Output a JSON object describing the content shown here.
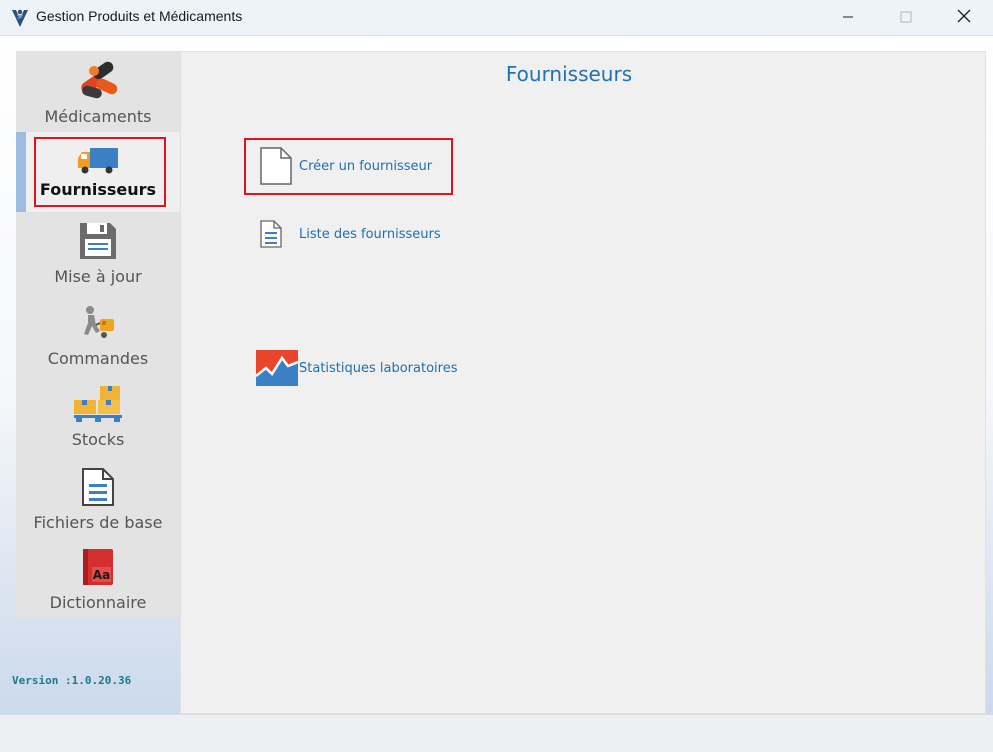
{
  "window": {
    "title": "Gestion Produits et Médicaments",
    "icon": "caduceus-icon"
  },
  "sidebar": {
    "items": [
      {
        "label": "Médicaments",
        "icon": "pills-icon",
        "active": false
      },
      {
        "label": "Fournisseurs",
        "icon": "truck-icon",
        "active": true
      },
      {
        "label": "Mise à jour",
        "icon": "floppy-disk-icon",
        "active": false
      },
      {
        "label": "Commandes",
        "icon": "delivery-man-icon",
        "active": false
      },
      {
        "label": "Stocks",
        "icon": "boxes-pallet-icon",
        "active": false
      },
      {
        "label": "Fichiers de base",
        "icon": "document-icon",
        "active": false
      },
      {
        "label": "Dictionnaire",
        "icon": "dictionary-icon",
        "active": false
      }
    ],
    "version": "Version :1.0.20.36"
  },
  "main": {
    "title": "Fournisseurs",
    "actions": [
      {
        "label": "Créer un fournisseur",
        "icon": "new-document-icon",
        "highlighted": true
      },
      {
        "label": "Liste des fournisseurs",
        "icon": "list-document-icon",
        "highlighted": false
      },
      {
        "label": "Statistiques laboratoires",
        "icon": "statistics-chart-icon",
        "highlighted": false
      }
    ]
  },
  "colors": {
    "accent": "#2072b8",
    "highlight_frame": "#e0141e",
    "version_text": "#1b7a8c",
    "active_bar": "#9dbde0"
  }
}
